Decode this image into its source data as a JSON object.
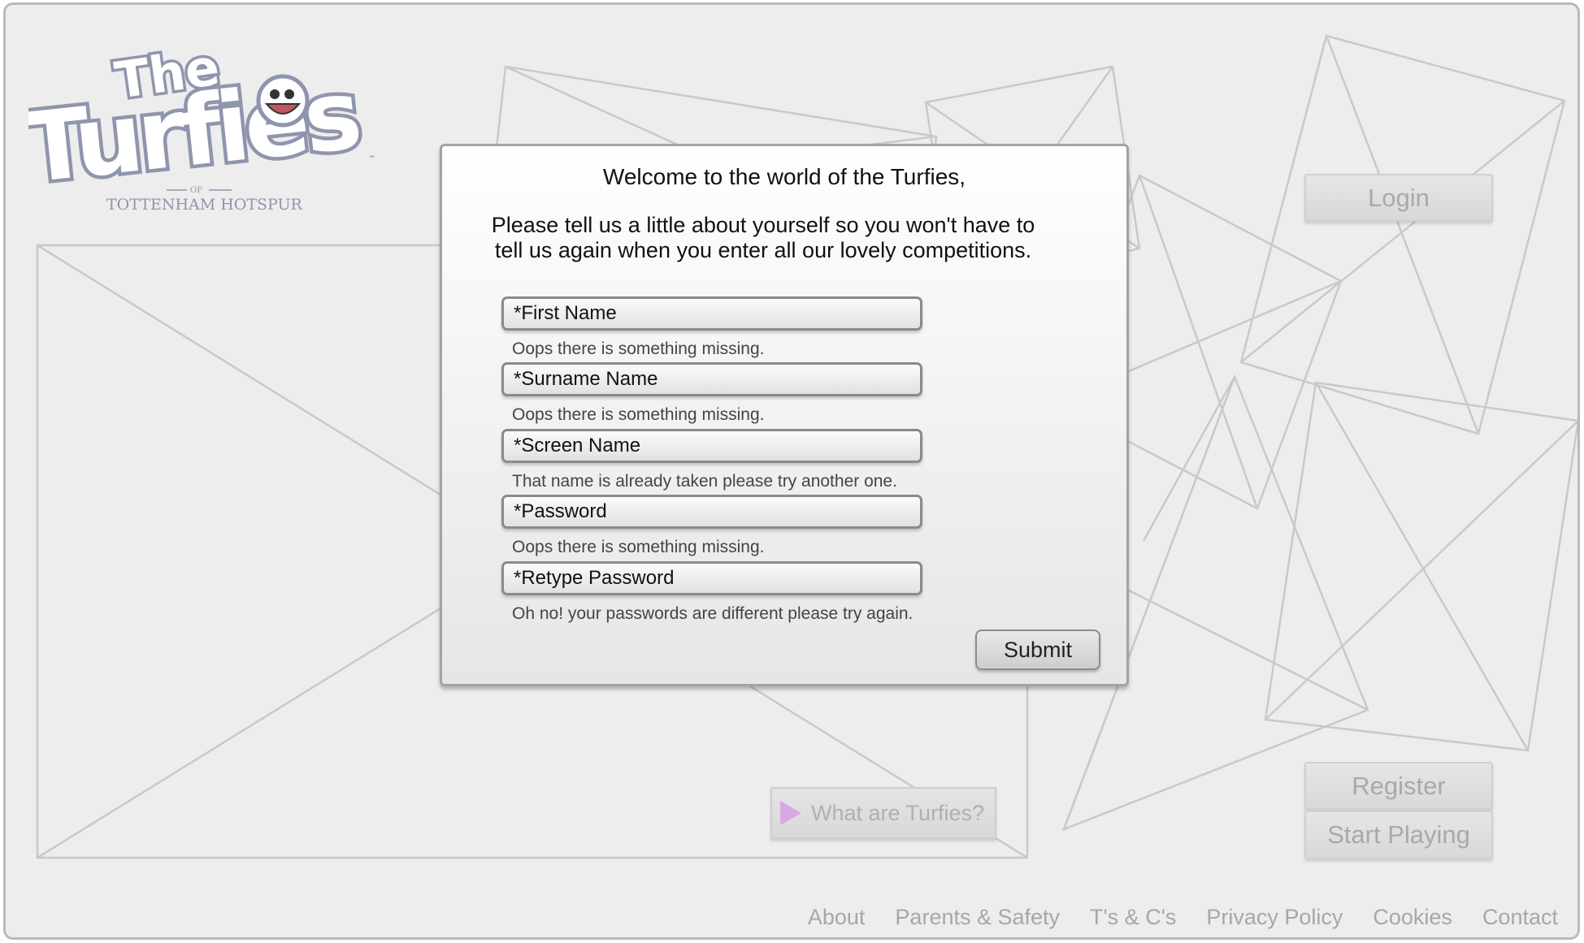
{
  "logo": {
    "title_small": "The",
    "title_big": "Turfies",
    "of": "OF",
    "club": "TOTTENHAM HOTSPUR",
    "tm": "™"
  },
  "header": {
    "login_label": "Login"
  },
  "dialog": {
    "title": "Welcome to the world of the Turfies,",
    "intro": "Please tell us a little about yourself so you won't have to tell us again when you enter all our lovely competitions.",
    "fields": [
      {
        "placeholder": "*First Name",
        "error": "Oops there is something missing."
      },
      {
        "placeholder": "*Surname Name",
        "error": "Oops there is something missing."
      },
      {
        "placeholder": "*Screen Name",
        "error": "That name is already taken please try another one."
      },
      {
        "placeholder": "*Password",
        "error": "Oops there is something missing."
      },
      {
        "placeholder": "*Retype Password",
        "error": "Oh no! your passwords are different please try again."
      }
    ],
    "submit_label": "Submit"
  },
  "video": {
    "label": "What are Turfies?",
    "play_color": "#d8a7e3"
  },
  "actions": {
    "register_label": "Register",
    "start_label": "Start Playing"
  },
  "footer": {
    "links": [
      "About",
      "Parents & Safety",
      "T's & C's",
      "Privacy Policy",
      "Cookies",
      "Contact"
    ]
  },
  "colors": {
    "background": "#ededed",
    "placeholder_lines": "#c9c9c9",
    "logo": "#9aa0b4"
  }
}
